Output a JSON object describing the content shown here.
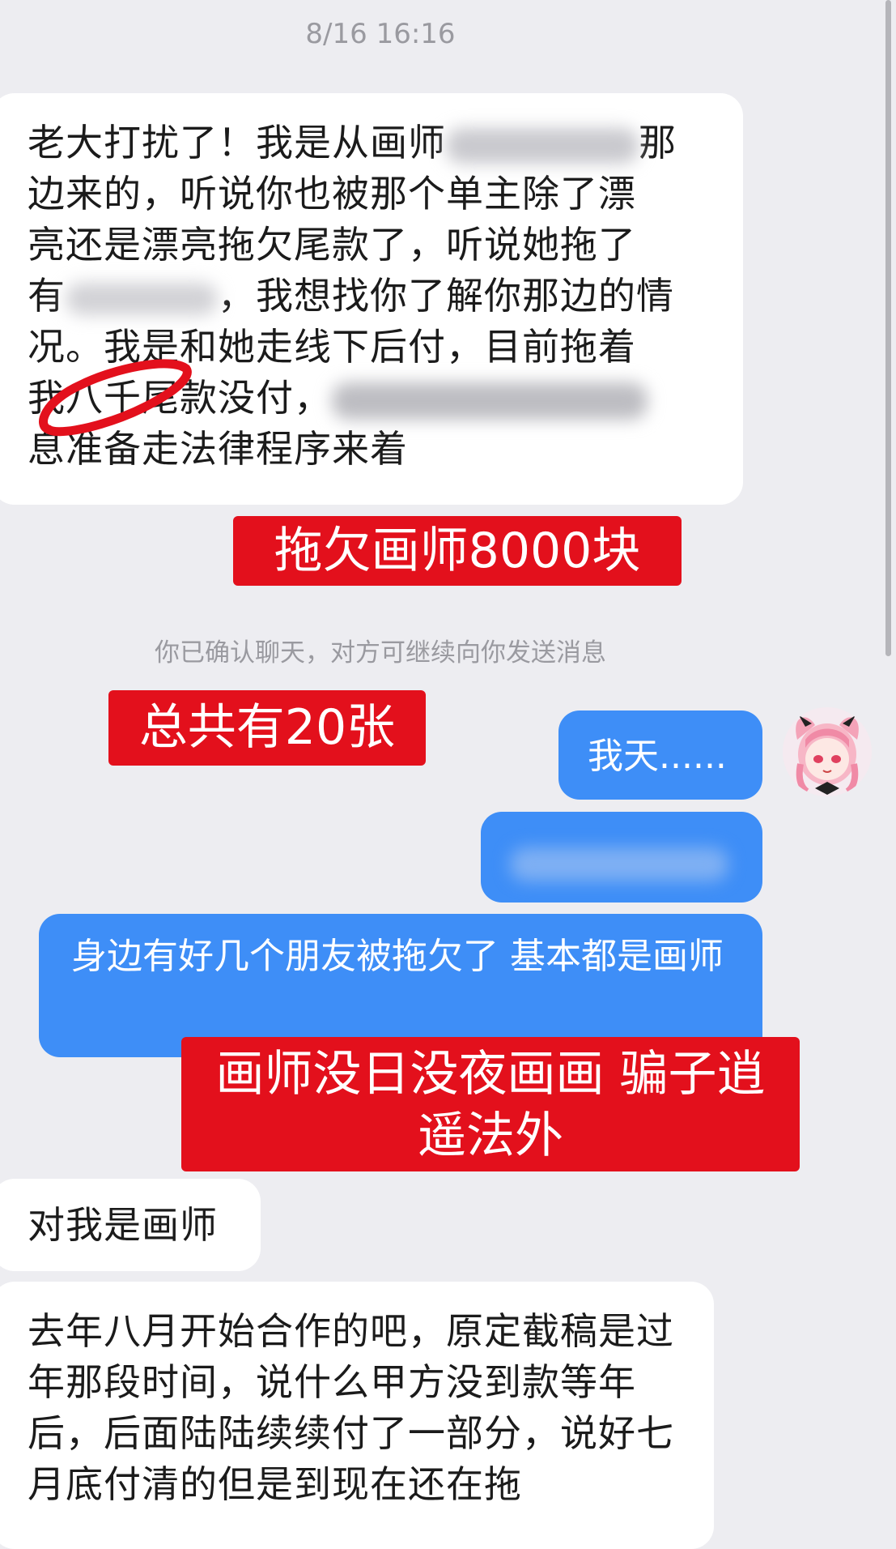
{
  "conversation": {
    "timestamp": "8/16 16:16",
    "system_note": "你已确认聊天，对方可继续向你发送消息"
  },
  "messages": {
    "first": {
      "line1_pre": "老大打扰了！我是从画师",
      "line1_post": "那",
      "line2": "边来的，听说你也被那个单主除了漂",
      "line3": "亮还是漂亮拖欠尾款了，听说她拖了",
      "line4_pre": "有",
      "line4_post": "，我想找你了解你那边的情",
      "line5": "况。我是和她走线下后付，目前拖着",
      "line6_pre": "我八千尾款没付，",
      "line7": "息准备走法律程序来着"
    },
    "sent_1": "我天......",
    "sent_3": "身边有好几个朋友被拖欠了 基本都是画师",
    "reply_1": "对我是画师",
    "reply_2": "去年八月开始合作的吧，原定截稿是过年那段时间，说什么甲方没到款等年后，后面陆陆续续付了一部分，说好七月底付清的但是到现在还在拖"
  },
  "annotations": {
    "label_1": "拖欠画师8000块",
    "label_2": "总共有20张",
    "label_3": "画师没日没夜画画 骗子逍遥法外"
  },
  "colors": {
    "background": "#ededf1",
    "outgoing_bubble": "#3e8ef7",
    "annotation_red": "#e3101c"
  },
  "icons": {
    "avatar": "anime-girl-avatar-icon"
  }
}
